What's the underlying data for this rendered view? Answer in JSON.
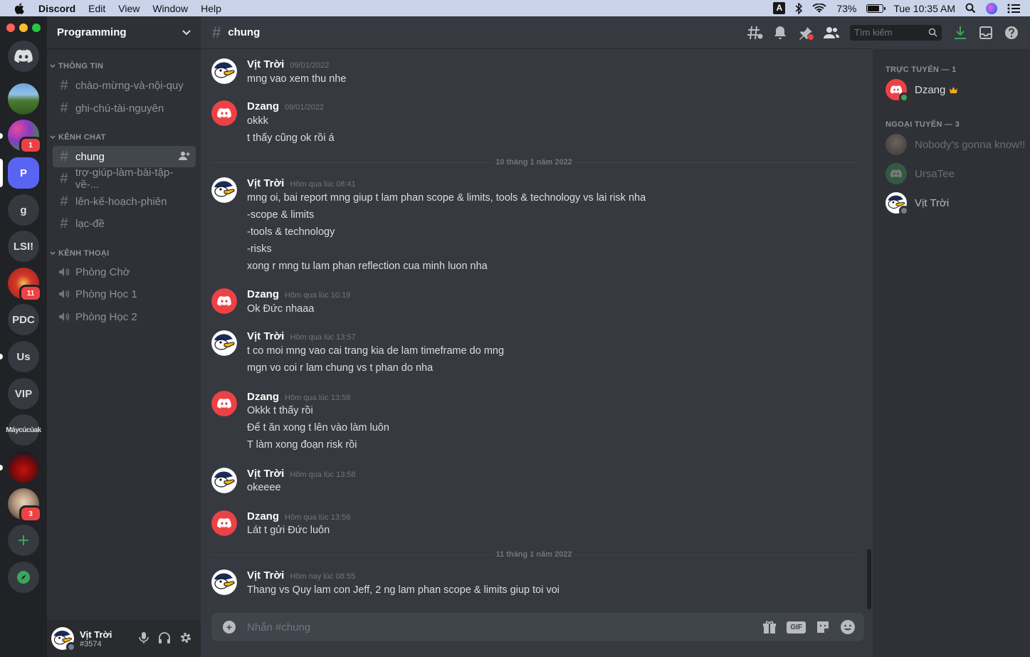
{
  "menubar": {
    "app": "Discord",
    "menus": [
      "Edit",
      "View",
      "Window",
      "Help"
    ],
    "input_source": "A",
    "battery": "73%",
    "clock": "Tue 10:35 AM"
  },
  "servers": [
    {
      "label": "",
      "badge": ""
    },
    {
      "label": "",
      "badge": "1"
    },
    {
      "label": "P",
      "badge": ""
    },
    {
      "label": "g",
      "badge": ""
    },
    {
      "label": "LSI!",
      "badge": ""
    },
    {
      "label": "",
      "badge": "11"
    },
    {
      "label": "PDC",
      "badge": ""
    },
    {
      "label": "Us",
      "badge": ""
    },
    {
      "label": "VIP",
      "badge": ""
    },
    {
      "label": "Máycúcủak",
      "badge": ""
    },
    {
      "label": "",
      "badge": ""
    },
    {
      "label": "",
      "badge": "3"
    }
  ],
  "guild": {
    "name": "Programming"
  },
  "categories": {
    "info": "THÔNG TIN",
    "chat": "KÊNH CHAT",
    "voice": "KÊNH THOẠI"
  },
  "channels": {
    "info": [
      "chào-mừng-và-nội-quy",
      "ghi-chú-tài-nguyên"
    ],
    "chat": [
      "chung",
      "trợ-giúp-làm-bài-tập-về-...",
      "lên-kế-hoạch-phiên",
      "lạc-đề"
    ],
    "voice": [
      "Phòng Chờ",
      "Phòng Học 1",
      "Phòng Học 2"
    ]
  },
  "user": {
    "name": "Vịt Trời",
    "tag": "#3574"
  },
  "header": {
    "channel": "chung",
    "search_placeholder": "Tìm kiếm"
  },
  "messages": [
    {
      "author": "Vịt Trời",
      "time": "09/01/2022",
      "lines": [
        "mng vao xem thu nhe"
      ]
    },
    {
      "author": "Dzang",
      "time": "09/01/2022",
      "lines": [
        "okkk",
        "t thấy cũng ok rồi á"
      ]
    },
    {
      "author": "Vịt Trời",
      "time": "Hôm qua lúc 08:41",
      "lines": [
        "mng oi, bai report mng giup t lam phan scope & limits, tools & technology vs lai risk nha",
        "-scope & limits",
        "-tools & technology",
        "-risks",
        "xong r mng tu lam phan reflection cua minh luon nha"
      ]
    },
    {
      "author": "Dzang",
      "time": "Hôm qua lúc 10:19",
      "lines": [
        "Ok Đức nhaaa"
      ]
    },
    {
      "author": "Vịt Trời",
      "time": "Hôm qua lúc 13:57",
      "lines": [
        "t co moi mng vao cai trang kia de lam timeframe do mng",
        "mgn vo coi r lam chung vs t phan do nha"
      ]
    },
    {
      "author": "Dzang",
      "time": "Hôm qua lúc 13:58",
      "lines": [
        "Okkk t thấy rồi",
        "Để t ăn xong t lên vào làm luôn",
        "T làm xong đoạn risk rồi"
      ]
    },
    {
      "author": "Vịt Trời",
      "time": "Hôm qua lúc 13:58",
      "lines": [
        "okeeee"
      ]
    },
    {
      "author": "Dzang",
      "time": "Hôm qua lúc 13:58",
      "lines": [
        "Lát t gửi Đức luôn"
      ]
    },
    {
      "author": "Vịt Trời",
      "time": "Hôm nay lúc 08:55",
      "lines": [
        "Thang vs Quy lam con Jeff, 2 ng lam phan scope & limits giup toi voi"
      ]
    }
  ],
  "dividers": [
    "10 tháng 1 năm 2022",
    "11 tháng 1 năm 2022"
  ],
  "composer": {
    "placeholder": "Nhắn #chung",
    "gif": "GIF"
  },
  "members": {
    "online_header": "TRỰC TUYẾN — 1",
    "offline_header": "NGOẠI TUYẾN — 3",
    "online": [
      "Dzang"
    ],
    "offline": [
      "Nobody's gonna know!!",
      "UrsaTee",
      "Vịt Trời"
    ]
  },
  "colors": {
    "blurple": "#5865f2",
    "discord_red": "#ed4245",
    "online": "#3ba55d",
    "crown": "#faa81a"
  }
}
